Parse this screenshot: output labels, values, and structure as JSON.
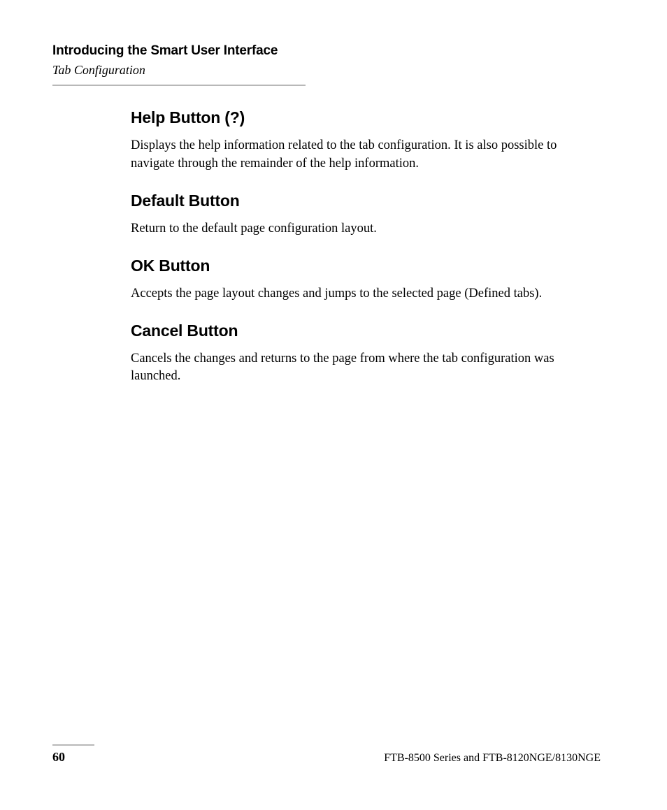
{
  "header": {
    "chapter_title": "Introducing the Smart User Interface",
    "section_subtitle": "Tab Configuration"
  },
  "sections": [
    {
      "heading": "Help Button (?)",
      "body": "Displays the help information related to the tab configuration. It is also possible to navigate through the remainder of the help information."
    },
    {
      "heading": "Default Button",
      "body": "Return to the default page configuration layout."
    },
    {
      "heading": "OK Button",
      "body": "Accepts the page layout changes and jumps to the selected page (Defined tabs)."
    },
    {
      "heading": "Cancel Button",
      "body": "Cancels the changes and returns to the page from where the tab configuration was launched."
    }
  ],
  "footer": {
    "page_number": "60",
    "doc_title": "FTB-8500 Series and FTB-8120NGE/8130NGE"
  }
}
